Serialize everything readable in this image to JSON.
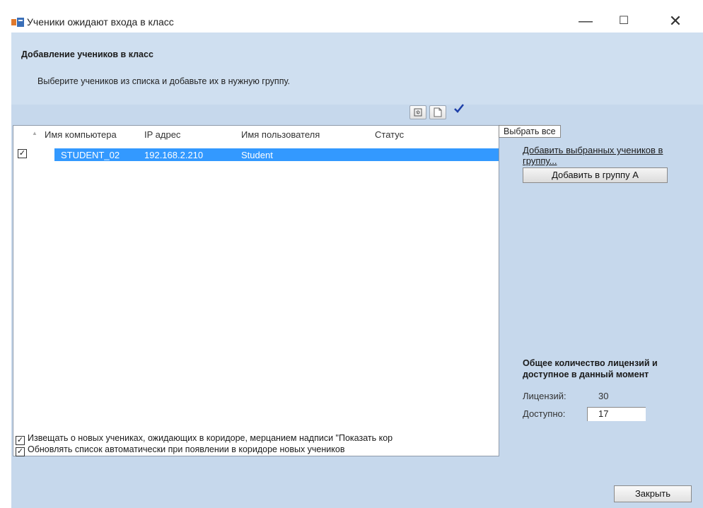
{
  "window": {
    "title": "Ученики ожидают входа в класс",
    "controls": {
      "minimize": "—",
      "maximize": "☐",
      "close": "✕"
    }
  },
  "header": {
    "heading": "Добавление учеников в класс",
    "subheading": "Выберите учеников из списка и добавьте их в нужную группу."
  },
  "toolbar": {
    "refresh_icon": "refresh-icon",
    "new_icon": "new-document-icon",
    "select_all_icon": "checkmark-icon",
    "tooltip": "Выбрать все"
  },
  "list": {
    "columns": [
      "Имя компьютера",
      "IP адрес",
      "Имя пользователя",
      "Статус"
    ],
    "rows": [
      {
        "checked": true,
        "computer": "STUDENT_02",
        "ip": "192.168.2.210",
        "user": "Student",
        "status": ""
      }
    ]
  },
  "side": {
    "add_link": "Добавить выбранных учеников в группу...",
    "add_button": "Добавить в группу А"
  },
  "licenses": {
    "title": "Общее количество лицензий и доступное в данный момент",
    "total_label": "Лицензий:",
    "total_value": "30",
    "available_label": "Доступно:",
    "available_value": "17"
  },
  "options": {
    "notify": {
      "checked": true,
      "label": "Извещать о новых учениках, ожидающих в коридоре, мерцанием надписи \"Показать кор"
    },
    "autorefresh": {
      "checked": true,
      "label": "Обновлять список автоматически при появлении в коридоре новых учеников"
    }
  },
  "footer": {
    "close_button": "Закрыть"
  },
  "colors": {
    "panel": "#c6d8ec",
    "selection": "#3399ff",
    "check_icon": "#1d3fa8"
  }
}
